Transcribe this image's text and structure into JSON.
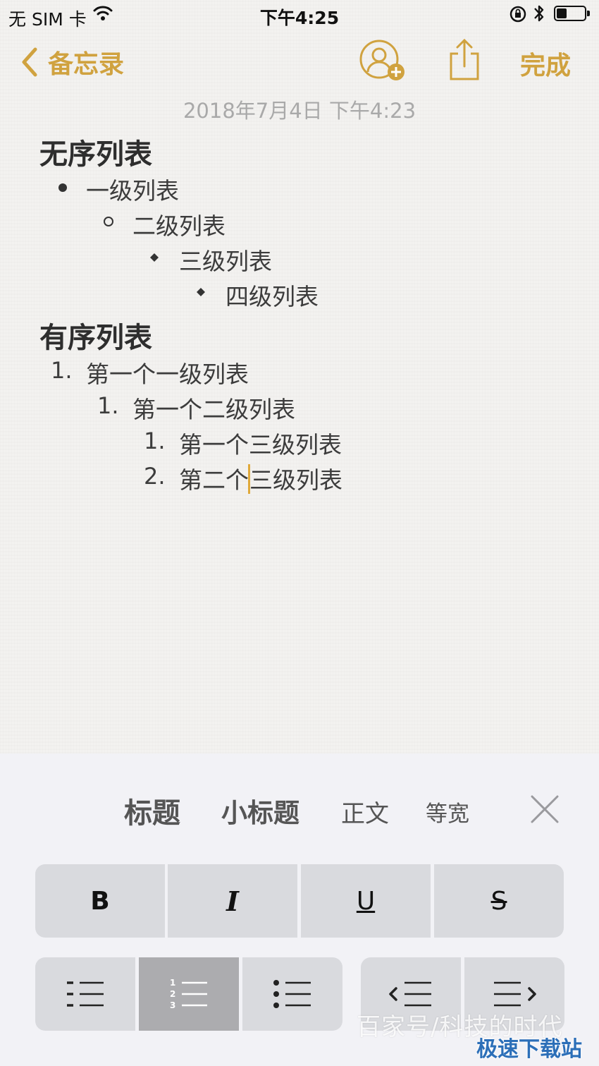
{
  "status_bar": {
    "carrier": "无 SIM 卡",
    "time": "下午4:25"
  },
  "nav": {
    "back_label": "备忘录",
    "done_label": "完成"
  },
  "note": {
    "timestamp": "2018年7月4日 下午4:23",
    "unordered_heading": "无序列表",
    "unordered_items": [
      "一级列表",
      "二级列表",
      "三级列表",
      "四级列表"
    ],
    "ordered_heading": "有序列表",
    "ordered_items": [
      {
        "number": "1.",
        "text": "第一个一级列表"
      },
      {
        "number": "1.",
        "text": "第一个二级列表"
      },
      {
        "number": "1.",
        "text": "第一个三级列表"
      },
      {
        "number": "2.",
        "text_before_cursor": "第二个",
        "text_after_cursor": "三级列表"
      }
    ]
  },
  "format_panel": {
    "styles": [
      "标题",
      "小标题",
      "正文",
      "等宽"
    ],
    "text_buttons": [
      "B",
      "I",
      "U",
      "S"
    ],
    "list_buttons": [
      "dash-list-icon",
      "numbered-list-icon",
      "bullet-list-icon"
    ],
    "selected_list_button": "numbered-list-icon",
    "indent_buttons": [
      "outdent-icon",
      "indent-icon"
    ]
  },
  "watermark": {
    "line1": "百家号/科技的时代",
    "line2": "极速下载站"
  },
  "colors": {
    "accent": "#d0a23f",
    "cursor": "#e0a93a",
    "selected_button": "#acacaf",
    "button": "#d9dade"
  }
}
